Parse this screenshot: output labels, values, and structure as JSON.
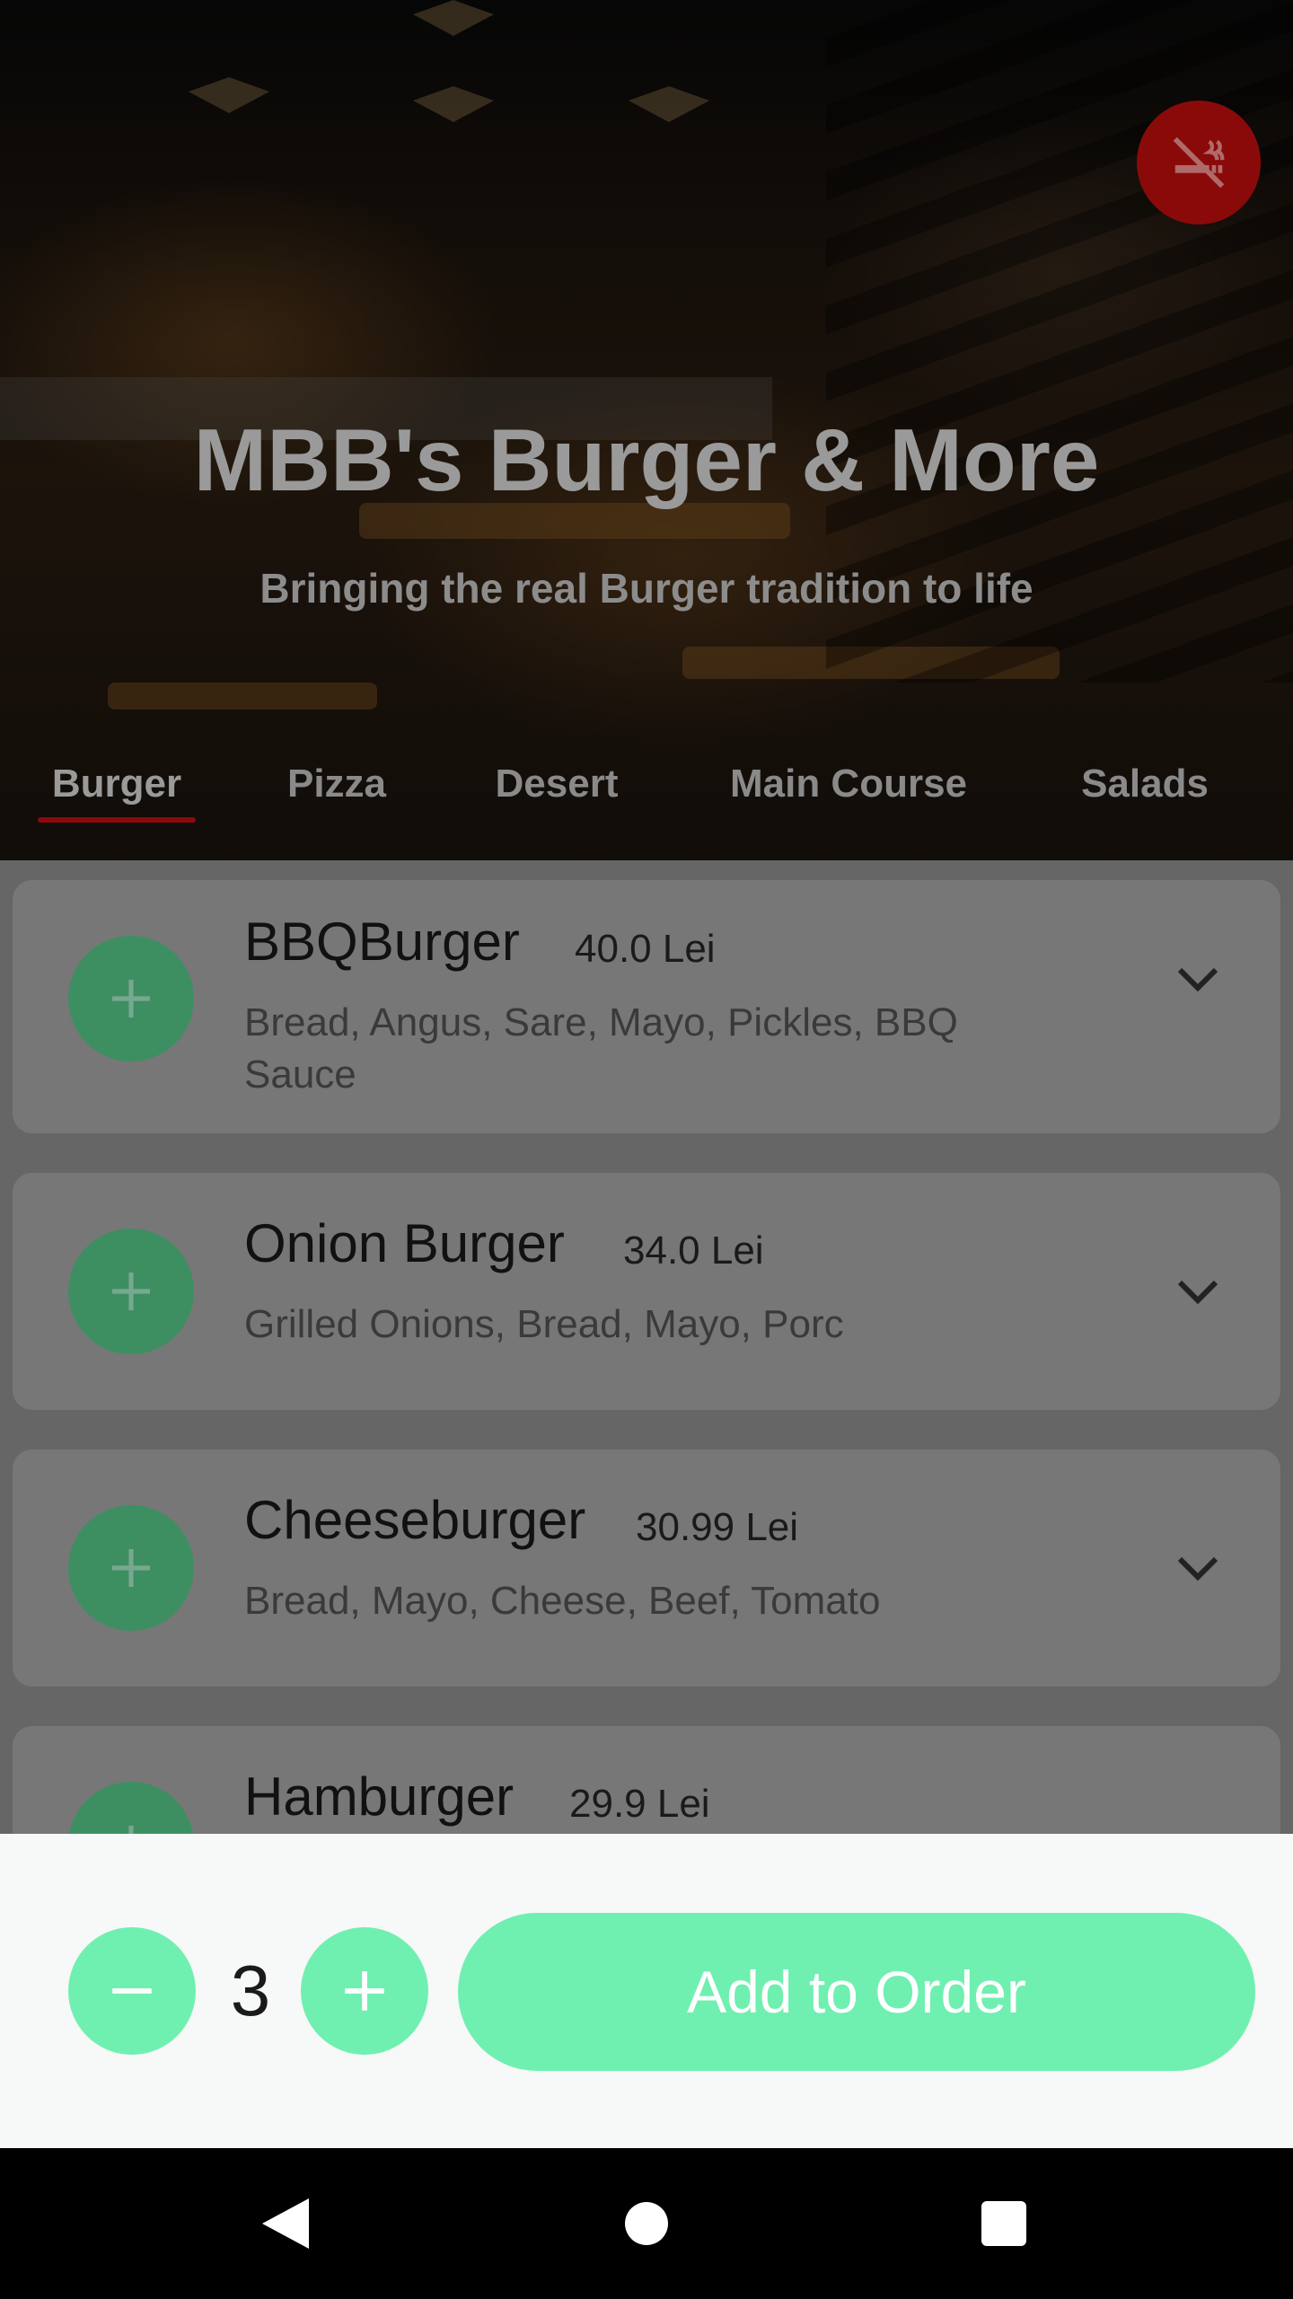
{
  "header": {
    "title": "MBB's Burger & More",
    "subtitle": "Bringing the real Burger tradition to life",
    "no_smoking_icon": "no-smoking-icon"
  },
  "tabs": [
    {
      "label": "Burger",
      "active": true
    },
    {
      "label": "Pizza",
      "active": false
    },
    {
      "label": "Desert",
      "active": false
    },
    {
      "label": "Main Course",
      "active": false
    },
    {
      "label": "Salads",
      "active": false
    }
  ],
  "menu_items": [
    {
      "name": "BBQBurger",
      "price": "40.0 Lei",
      "description": "Bread, Angus, Sare, Mayo, Pickles, BBQ Sauce"
    },
    {
      "name": "Onion Burger",
      "price": "34.0 Lei",
      "description": "Grilled Onions, Bread, Mayo, Porc"
    },
    {
      "name": "Cheeseburger",
      "price": "30.99 Lei",
      "description": "Bread, Mayo, Cheese, Beef, Tomato"
    },
    {
      "name": "Hamburger",
      "price": "29.9 Lei",
      "description": ""
    }
  ],
  "order": {
    "quantity": "3",
    "add_label": "Add to Order"
  },
  "colors": {
    "accent_green": "#6ff0b0",
    "dimmed_green": "#3d8f62",
    "tab_indicator": "#8b0a0a",
    "no_smoking_bg": "#8a0a0a"
  },
  "nav": {
    "back_icon": "back-triangle-icon",
    "home_icon": "home-circle-icon",
    "recents_icon": "recents-square-icon"
  }
}
